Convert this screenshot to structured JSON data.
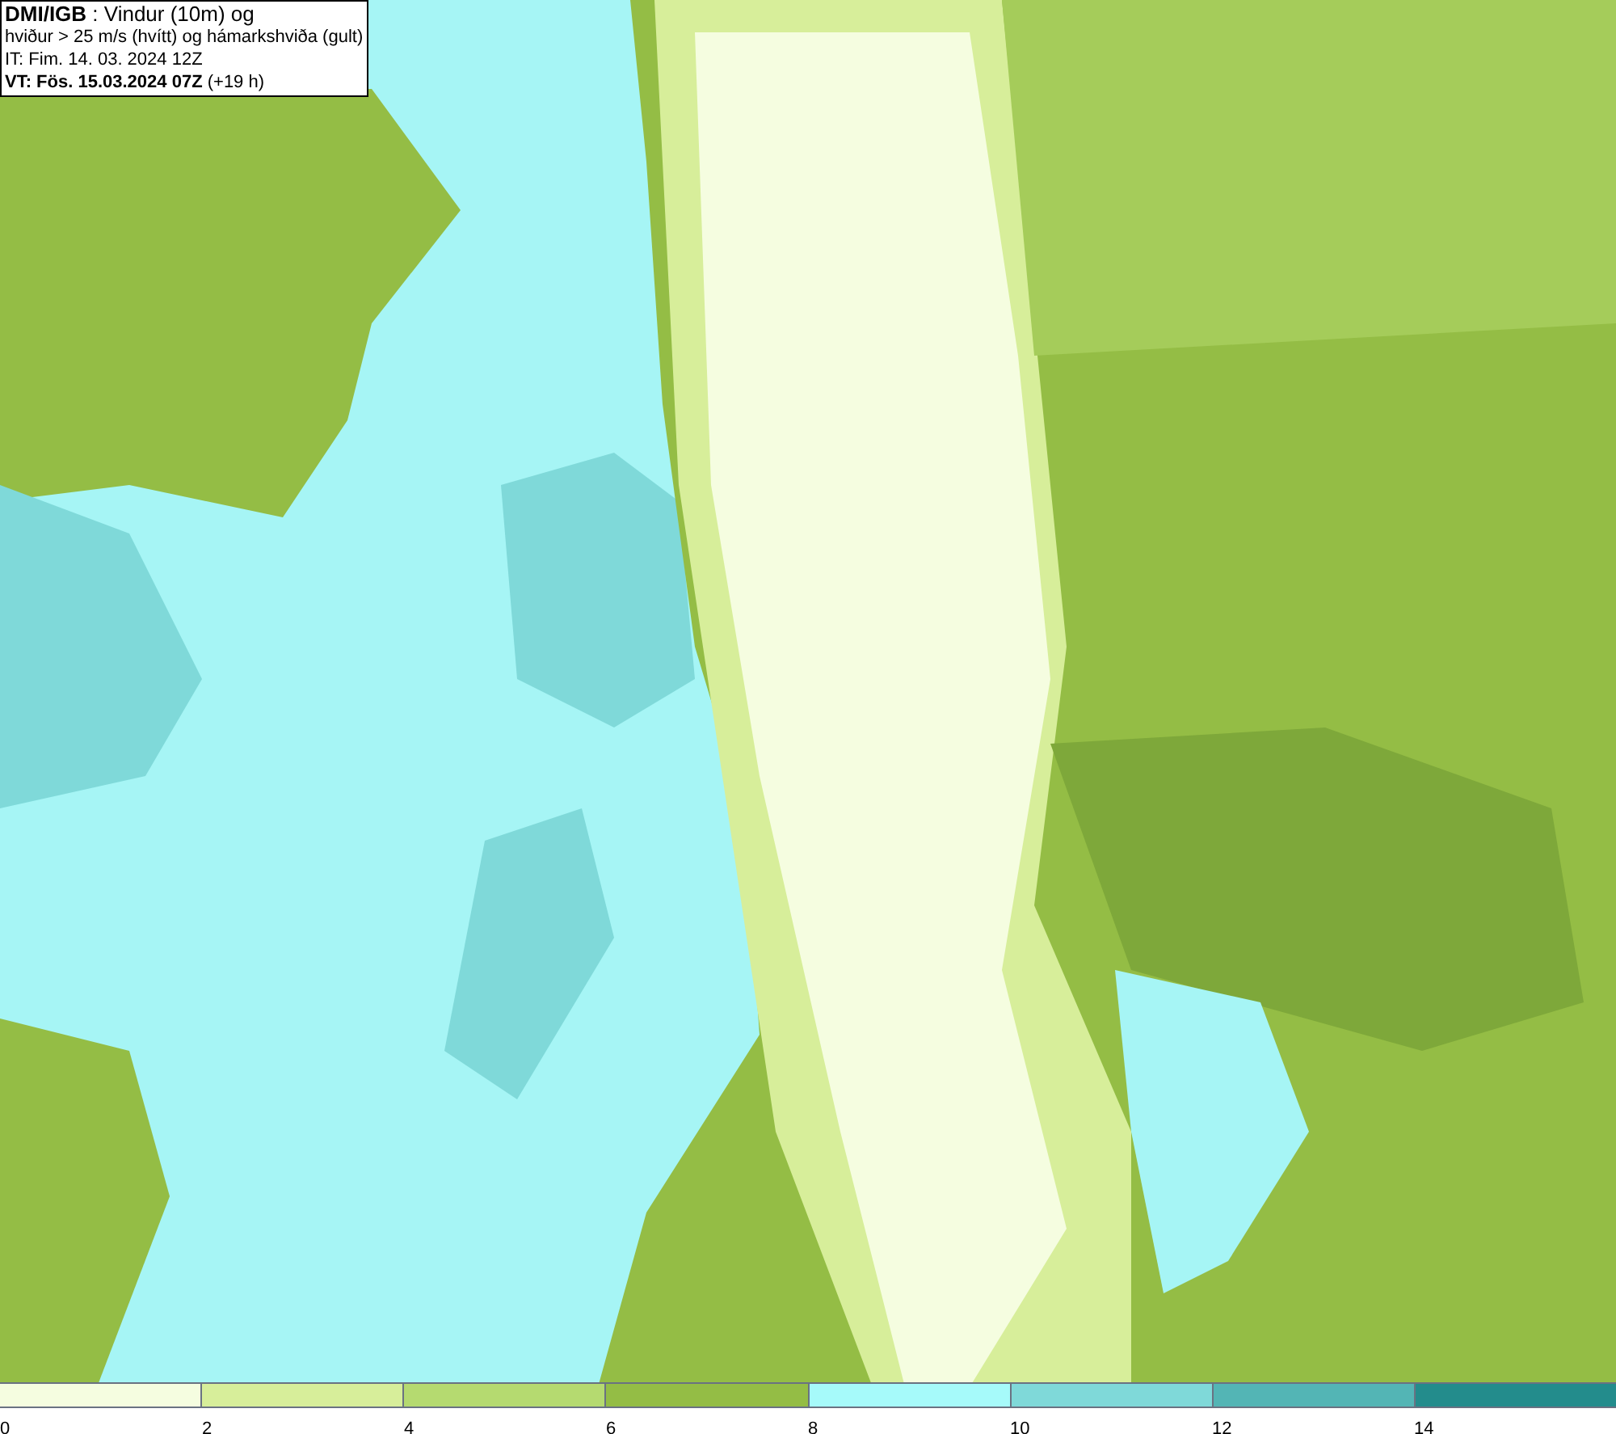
{
  "info": {
    "line1": "**DMI/IGB** : Vindur (10m) og",
    "line2": "hviður > 25 m/s (hvítt) og hámarkshviða (gult)",
    "line3": "IT: Fim. 14. 03. 2024 12Z",
    "line4": "**VT: Fös. 15.03.2024 07Z** (+19 h)"
  },
  "legend": {
    "segments": [
      {
        "color": "#f5fde0",
        "label": "0"
      },
      {
        "color": "#d7ee9a",
        "label": "2"
      },
      {
        "color": "#b5da70",
        "label": "4"
      },
      {
        "color": "#94bd45",
        "label": "6"
      },
      {
        "color": "#a6fafa",
        "label": "8"
      },
      {
        "color": "#7fd9d9",
        "label": "10"
      },
      {
        "color": "#53b5b5",
        "label": "12"
      },
      {
        "color": "#238c8c",
        "label": "14"
      }
    ]
  }
}
